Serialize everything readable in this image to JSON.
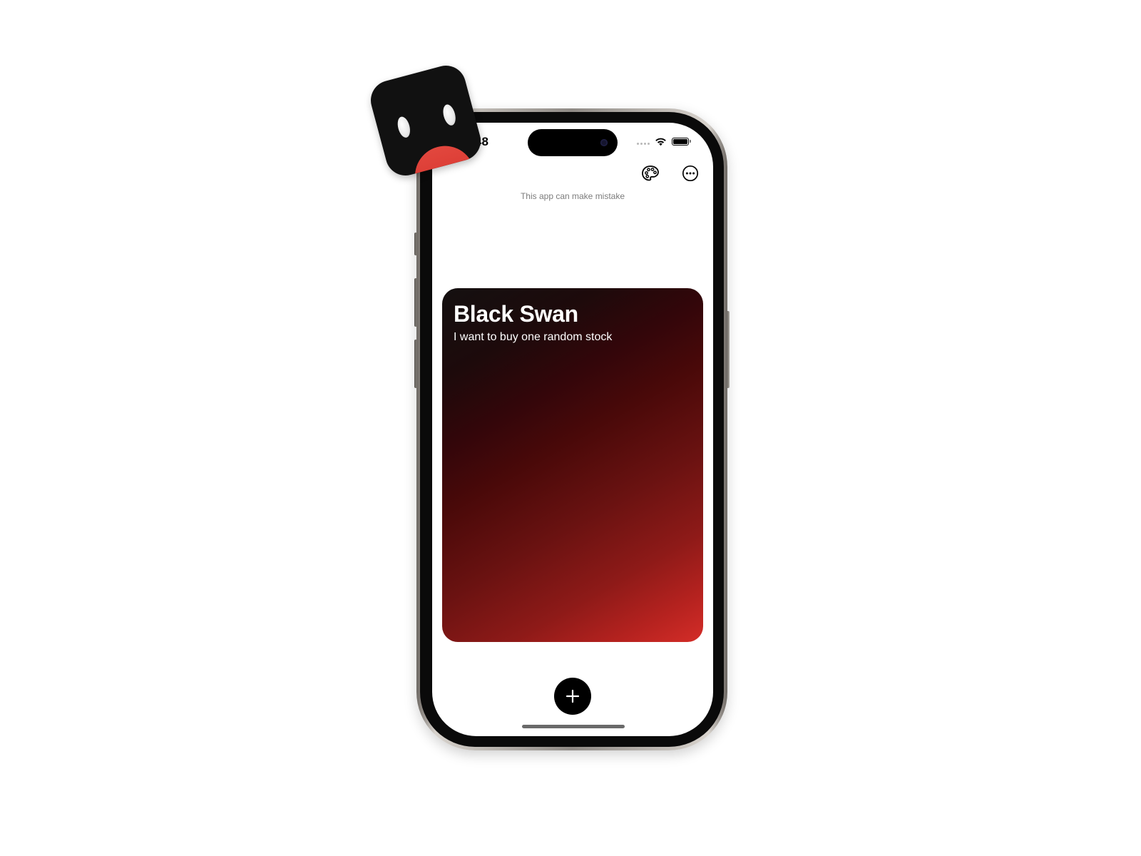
{
  "status_bar": {
    "time": ":48"
  },
  "toolbar": {
    "theme_icon": "palette-icon",
    "more_icon": "ellipsis-circle-icon"
  },
  "disclaimer": "This app can make mistake",
  "card": {
    "title": "Black Swan",
    "subtitle": "I want to buy one random stock",
    "gradient_colors": [
      "#141010",
      "#33060a",
      "#6a1211",
      "#d42d28"
    ]
  },
  "fab": {
    "icon": "plus-icon"
  },
  "colors": {
    "accent": "#d42d28",
    "button": "#000000",
    "mascot_mouth": "#e2473e"
  }
}
